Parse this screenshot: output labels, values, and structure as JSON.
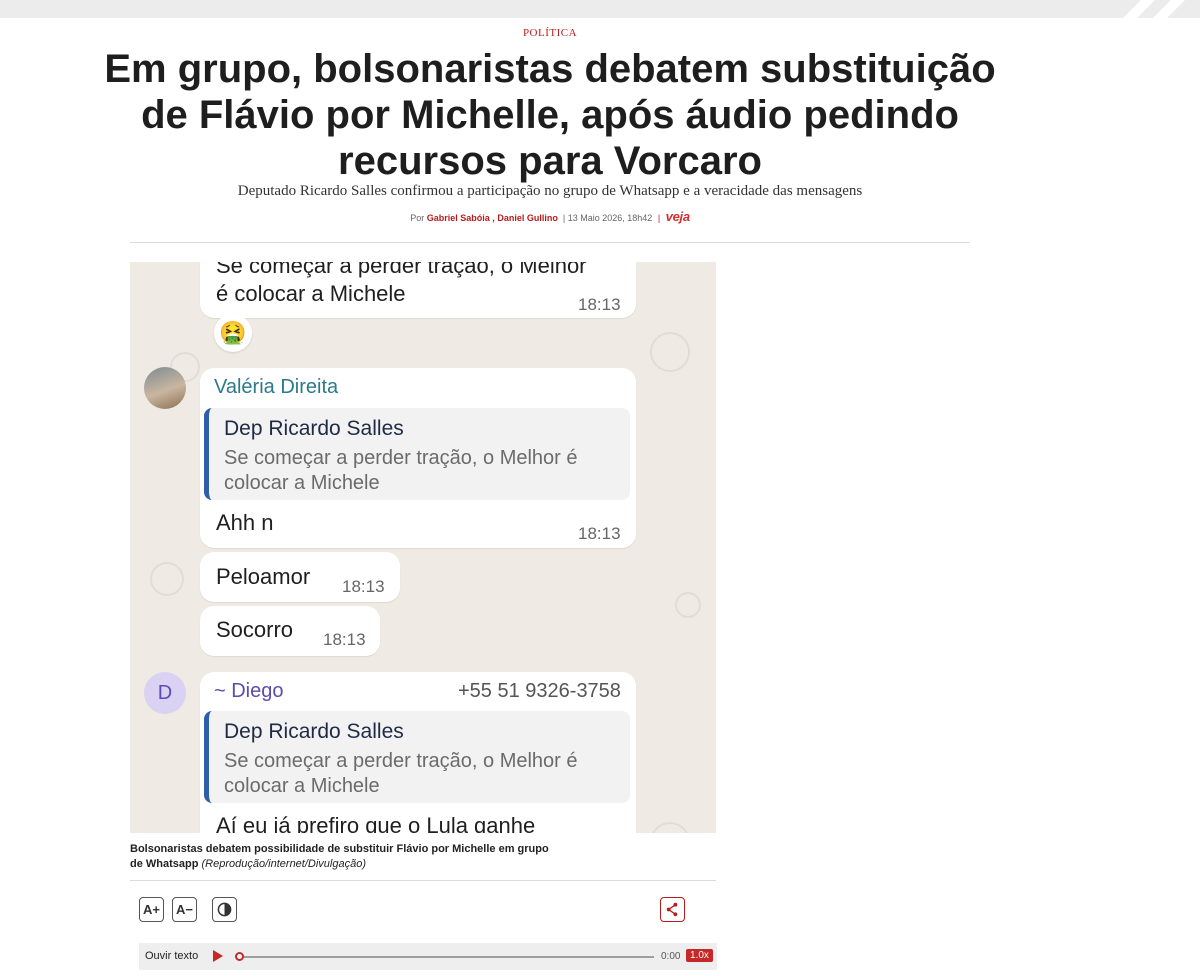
{
  "article": {
    "section": "POLÍTICA",
    "headline": "Em grupo, bolsonaristas debatem substituição de Flávio por Michelle, após áudio pedindo recursos para Vorcaro",
    "subtitle": "Deputado Ricardo Salles confirmou a participação no grupo de Whatsapp e a veracidade das mensagens",
    "byline": {
      "prefix": "Por",
      "author1": "Gabriel Sabóia",
      "author_sep": ",",
      "author2": "Daniel Gullino",
      "date": "13 Maio 2026, 18h42",
      "publication": "veja"
    }
  },
  "chat_image": {
    "top_message": {
      "line1": "Se começar a perder tração, o Melhor",
      "line2": "é colocar a Michele",
      "time": "18:13",
      "reaction": "🤮"
    },
    "valeria": {
      "sender": "Valéria Direita",
      "quote_name": "Dep Ricardo Salles",
      "quote_text": "Se começar a perder tração, o Melhor é colocar a Michele",
      "text": "Ahh n",
      "time": "18:13"
    },
    "peloamor": {
      "text": "Peloamor",
      "time": "18:13"
    },
    "socorro": {
      "text": "Socorro",
      "time": "18:13"
    },
    "diego": {
      "avatar_letter": "D",
      "sender": "~ Diego",
      "phone": "+55 51 9326-3758",
      "quote_name": "Dep Ricardo Salles",
      "quote_text": "Se começar a perder tração, o Melhor é colocar a Michele",
      "text": "Aí eu já prefiro que o Lula ganhe"
    }
  },
  "caption": {
    "text": "Bolsonaristas debatem possibilidade de substituir Flávio por Michelle em grupo de Whatsapp",
    "credit": "(Reprodução/internet/Divulgação)"
  },
  "toolbar": {
    "font_increase": "A+",
    "font_decrease": "A−",
    "contrast_icon": "contrast-icon",
    "share_icon": "share-icon"
  },
  "audio_player": {
    "label": "Ouvir texto",
    "current_time": "0:00",
    "speed": "1.0x",
    "progress": 0
  },
  "colors": {
    "accent": "#b71c1c",
    "quote_bar": "#2d5fa8",
    "chat_background": "#efebe4"
  }
}
